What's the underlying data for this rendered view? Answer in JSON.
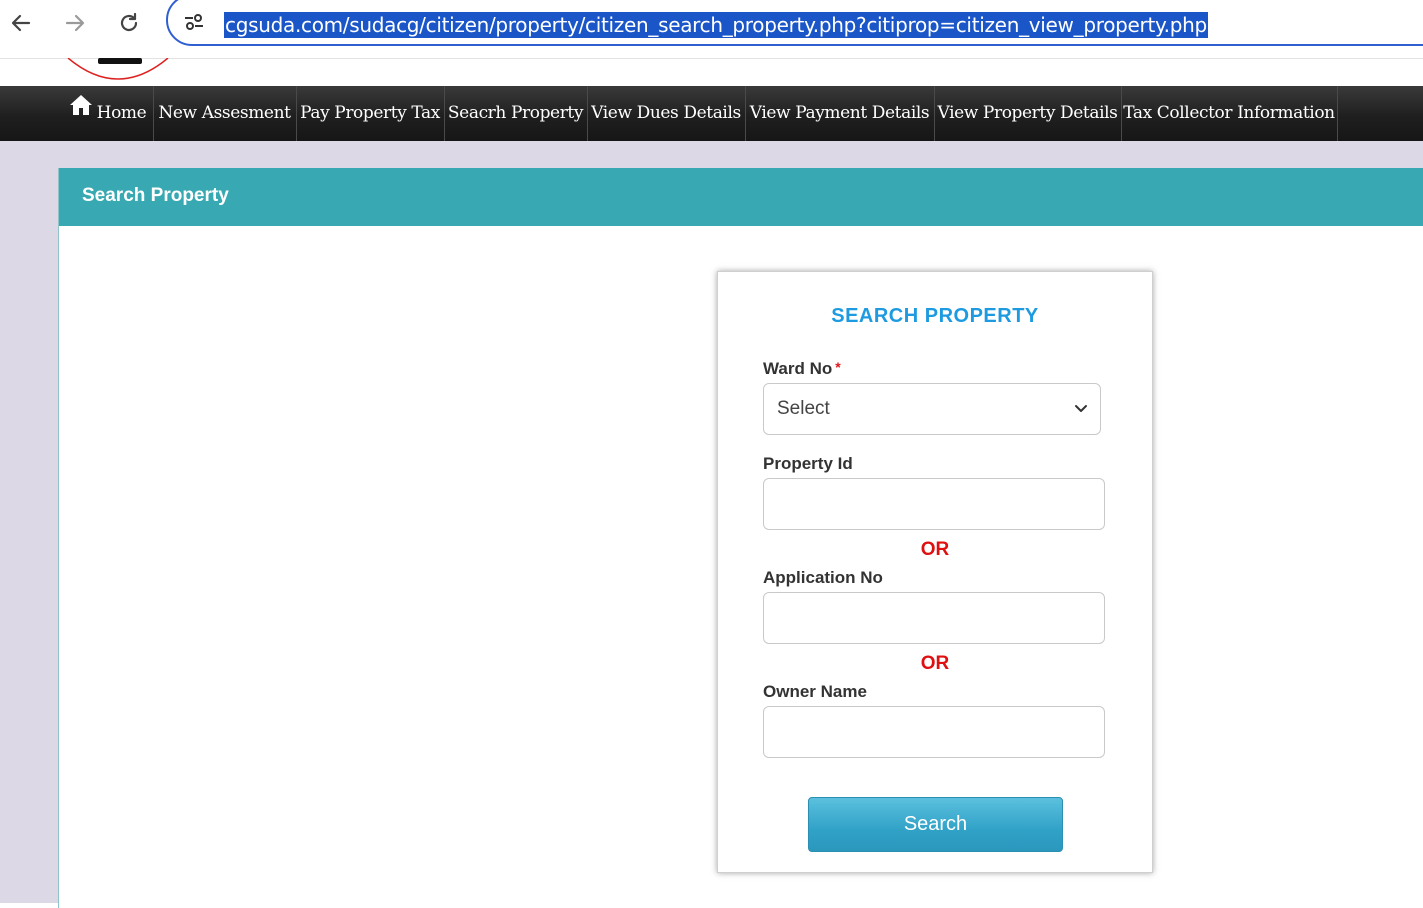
{
  "browser": {
    "url": "cgsuda.com/sudacg/citizen/property/citizen_search_property.php?citiprop=citizen_view_property.php"
  },
  "site_nav": {
    "items": [
      {
        "label": "Home"
      },
      {
        "label": "New Assesment"
      },
      {
        "label": "Pay Property Tax"
      },
      {
        "label": "Seacrh Property"
      },
      {
        "label": "View Dues Details"
      },
      {
        "label": "View Payment Details"
      },
      {
        "label": "View Property Details"
      },
      {
        "label": "Tax Collector Information"
      }
    ]
  },
  "panel": {
    "title": "Search Property"
  },
  "form": {
    "title": "SEARCH PROPERTY",
    "ward_label": "Ward No",
    "required_mark": "*",
    "ward_selected": "Select",
    "property_id_label": "Property Id",
    "property_id_value": "",
    "or_1": "OR",
    "application_no_label": "Application No",
    "application_no_value": "",
    "or_2": "OR",
    "owner_name_label": "Owner Name",
    "owner_name_value": "",
    "search_button": "Search"
  },
  "colors": {
    "header_teal": "#38a9b2",
    "title_blue": "#1e9be0",
    "or_red": "#e01010",
    "button_blue": "#31a2c7"
  },
  "icons": [
    "back-arrow-icon",
    "forward-arrow-icon",
    "reload-icon",
    "site-settings-icon",
    "home-icon",
    "chevron-down-icon"
  ]
}
